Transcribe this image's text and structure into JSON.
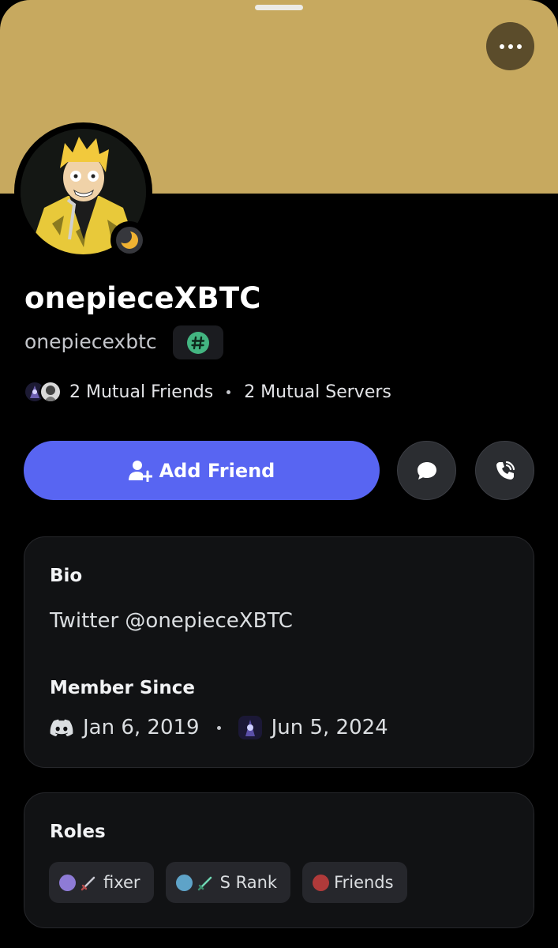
{
  "profile": {
    "display_name": "onepieceXBTC",
    "username": "onepiecexbtc",
    "status": "idle",
    "banner_color": "#c7a95f"
  },
  "mutuals": {
    "friends_label": "2 Mutual Friends",
    "servers_label": "2 Mutual Servers"
  },
  "actions": {
    "add_friend_label": "Add Friend",
    "message_icon": "chat-bubble-icon",
    "call_icon": "phone-call-icon"
  },
  "bio": {
    "title": "Bio",
    "text": "Twitter @onepieceXBTC"
  },
  "member_since": {
    "title": "Member Since",
    "discord_date": "Jan 6, 2019",
    "server_date": "Jun 5, 2024"
  },
  "roles": {
    "title": "Roles",
    "items": [
      {
        "name": "fixer",
        "color": "#8e7bd6",
        "emoji": "sword-icon"
      },
      {
        "name": "S Rank",
        "color": "#5ea3c8",
        "emoji": "sword-icon"
      },
      {
        "name": "Friends",
        "color": "#b03a3a"
      }
    ]
  },
  "colors": {
    "accent": "#5865f2",
    "card_bg": "#111214",
    "badge_green": "#43b581"
  }
}
